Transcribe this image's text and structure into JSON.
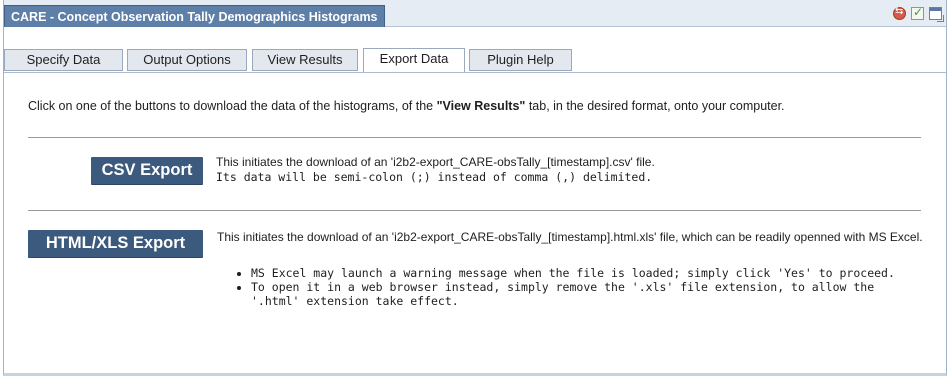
{
  "window": {
    "title": "CARE - Concept Observation Tally Demographics Histograms",
    "icons": [
      "swap-icon",
      "check-icon",
      "window-icon"
    ]
  },
  "tabs": [
    {
      "label": "Specify Data",
      "active": false
    },
    {
      "label": "Output Options",
      "active": false
    },
    {
      "label": "View Results",
      "active": false
    },
    {
      "label": "Export Data",
      "active": true
    },
    {
      "label": "Plugin Help",
      "active": false
    }
  ],
  "intro": {
    "before": "Click on one of the buttons to download the data of the histograms, of the ",
    "bold": "\"View Results\"",
    "after": " tab, in the desired format, onto your computer."
  },
  "csv": {
    "button_label": "CSV Export",
    "line1": "This initiates the download of an 'i2b2-export_CARE-obsTally_[timestamp].csv' file.",
    "line2": "Its data will be semi-colon (;) instead of comma (,) delimited."
  },
  "html_xls": {
    "button_label": "HTML/XLS Export",
    "description": "This initiates the download of an 'i2b2-export_CARE-obsTally_[timestamp].html.xls' file, which can be readily openned with MS Excel.",
    "notes": [
      "MS Excel may launch a warning message when the file is loaded; simply click 'Yes' to proceed.",
      "To open it in a web browser instead, simply remove the '.xls' file extension, to allow the '.html' extension take effect."
    ]
  },
  "colors": {
    "title_bg": "#5e7fa8",
    "button_bg": "#3c5a7d",
    "tab_bg": "#e3e8ef"
  }
}
